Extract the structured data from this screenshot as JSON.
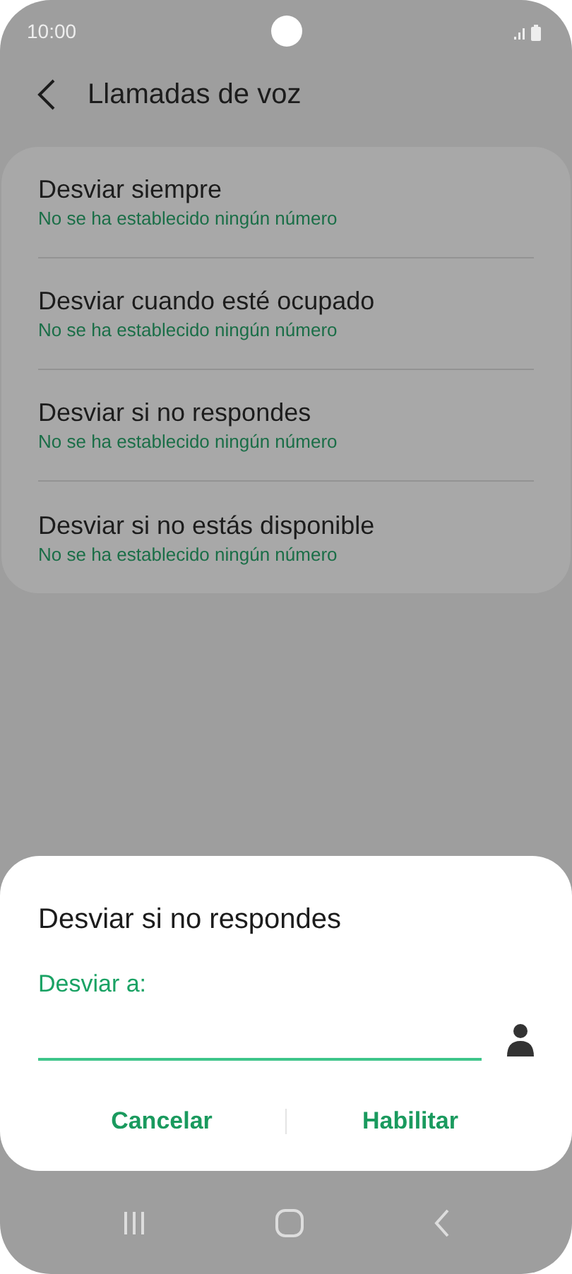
{
  "status_bar": {
    "time": "10:00"
  },
  "header": {
    "title": "Llamadas de voz"
  },
  "items": [
    {
      "title": "Desviar siempre",
      "subtitle": "No se ha establecido ningún número"
    },
    {
      "title": "Desviar cuando esté ocupado",
      "subtitle": "No se ha establecido ningún número"
    },
    {
      "title": "Desviar si no respondes",
      "subtitle": "No se ha establecido ningún número"
    },
    {
      "title": "Desviar si no estás disponible",
      "subtitle": "No se ha establecido ningún número"
    }
  ],
  "dialog": {
    "title": "Desviar si no respondes",
    "field_label": "Desviar a:",
    "buttons": [
      "Cancelar",
      "Habilitar"
    ]
  }
}
